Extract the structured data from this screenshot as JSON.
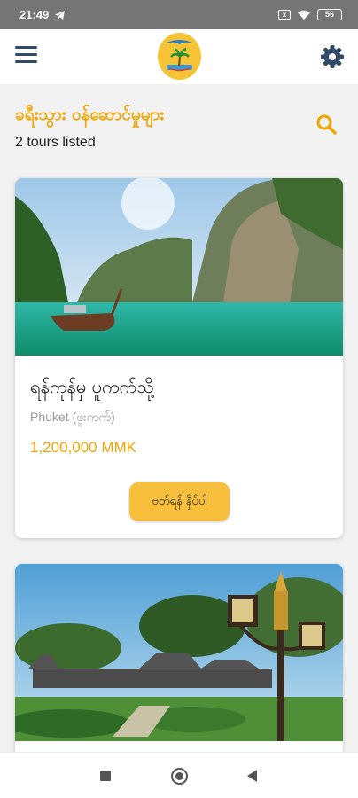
{
  "status_bar": {
    "time": "21:49",
    "signal_indicator": "x",
    "battery": "56"
  },
  "app_bar": {
    "menu_icon": "hamburger-menu-icon",
    "logo_icon": "travel-palm-logo",
    "settings_icon": "gear-icon"
  },
  "header": {
    "title": "ခရီးသွား ဝန်ဆောင်မှုများ",
    "subtitle": "2 tours listed",
    "search_icon": "search-icon"
  },
  "tours": [
    {
      "title": "ရန်ကုန်မှ ပူကက်သို့",
      "location": "Phuket (ဖူးကက်)",
      "price": "1,200,000 MMK",
      "button_label": "ဗတ်ရန် နှိပ်ပါ",
      "image": "tropical-lagoon-photo"
    },
    {
      "image": "palace-garden-photo"
    }
  ],
  "nav_bar": {
    "recents_icon": "square-icon",
    "home_icon": "circle-icon",
    "back_icon": "triangle-back-icon"
  },
  "colors": {
    "accent": "#f0a500",
    "button": "#f7bf3c",
    "status_bar": "#757575",
    "menu_icon": "#2f4b67",
    "background": "#f1f1f1"
  }
}
